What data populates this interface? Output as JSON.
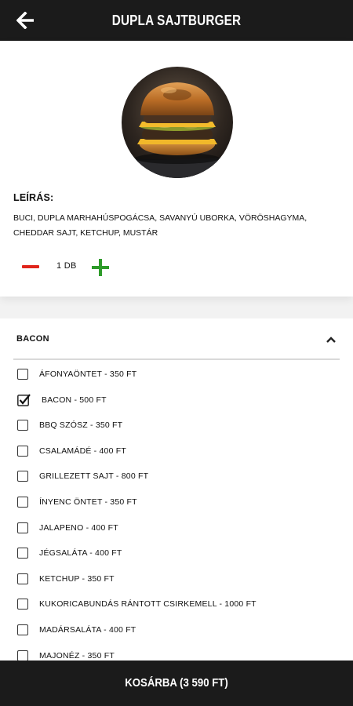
{
  "header": {
    "title": "DUPLA SAJTBURGER",
    "back_icon": "arrow-left-icon"
  },
  "product": {
    "image_icon": "burger-photo",
    "description_label": "LEÍRÁS:",
    "description": "BUCI, DUPLA MARHAHÚSPOGÁCSA, SAVANYÚ UBORKA, VÖRÖSHAGYMA, CHEDDAR SAJT, KETCHUP, MUSTÁR",
    "quantity": "1 DB"
  },
  "options": {
    "section_title": "BACON",
    "expanded": true,
    "items": [
      {
        "label": "ÁFONYAÖNTET - 350 FT",
        "checked": false
      },
      {
        "label": "BACON - 500 FT",
        "checked": true
      },
      {
        "label": "BBQ SZÓSZ - 350 FT",
        "checked": false
      },
      {
        "label": "CSALAMÁDÉ - 400 FT",
        "checked": false
      },
      {
        "label": "GRILLEZETT SAJT - 800 FT",
        "checked": false
      },
      {
        "label": "ÍNYENC ÖNTET - 350 FT",
        "checked": false
      },
      {
        "label": "JALAPENO - 400 FT",
        "checked": false
      },
      {
        "label": "JÉGSALÁTA - 400 FT",
        "checked": false
      },
      {
        "label": "KETCHUP - 350 FT",
        "checked": false
      },
      {
        "label": "KUKORICABUNDÁS RÁNTOTT CSIRKEMELL - 1000 FT",
        "checked": false
      },
      {
        "label": "MADÁRSALÁTA - 400 FT",
        "checked": false
      },
      {
        "label": "MAJONÉZ - 350 FT",
        "checked": false
      }
    ]
  },
  "footer": {
    "cart_label": "KOSÁRBA (3 590 FT)"
  },
  "colors": {
    "bar": "#1b1b1b",
    "minus": "#e0251b",
    "plus": "#2e9b2a"
  }
}
